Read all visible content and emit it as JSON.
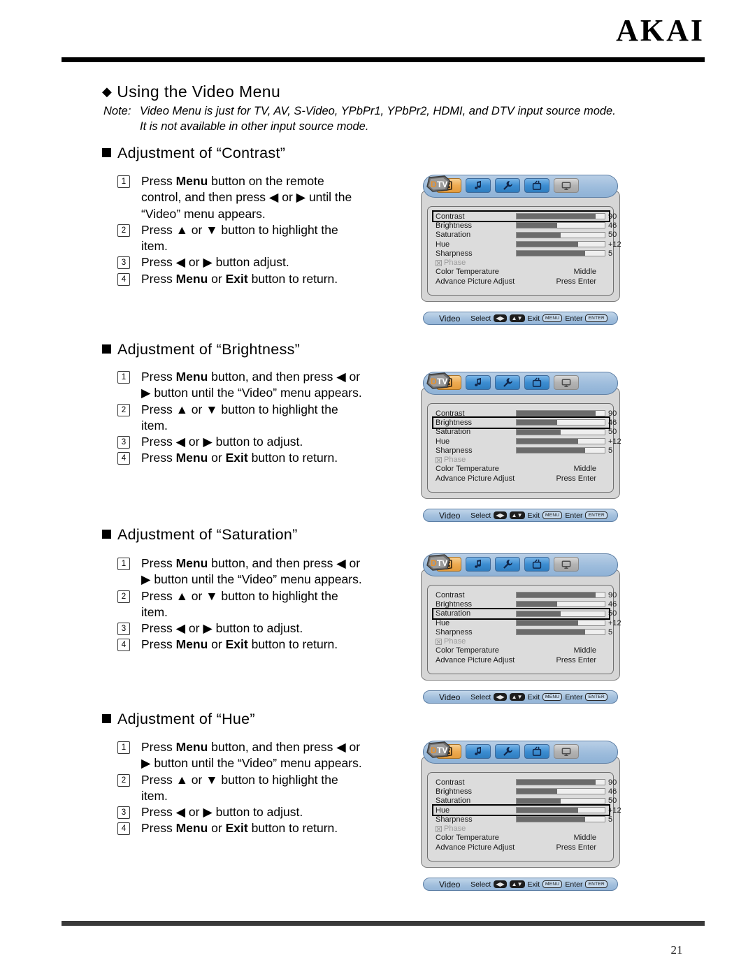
{
  "brand": "AKAI",
  "page_number": "21",
  "section_title": "Using the Video Menu",
  "note": {
    "label": "Note:",
    "line1": "Video Menu is just for TV, AV, S-Video, YPbPr1, YPbPr2, HDMI, and DTV input source mode.",
    "line2": "It is not available in other input source mode."
  },
  "sections": [
    {
      "heading": "Adjustment of “Contrast”",
      "steps": [
        {
          "num": "1",
          "lines": [
            "Press |Menu| button on the remote",
            "control, and then press ◀ or ▶ until the",
            "“Video” menu appears."
          ]
        },
        {
          "num": "2",
          "lines": [
            "Press ▲ or ▼ button to highlight the",
            "item."
          ]
        },
        {
          "num": "3",
          "lines": [
            "Press ◀ or ▶ button adjust."
          ]
        },
        {
          "num": "4",
          "lines": [
            "Press |Menu| or |Exit| button to return."
          ]
        }
      ],
      "selected": "Contrast"
    },
    {
      "heading": "Adjustment of “Brightness”",
      "steps": [
        {
          "num": "1",
          "lines": [
            "Press |Menu| button, and then press ◀ or",
            "▶ button until the “Video” menu appears."
          ]
        },
        {
          "num": "2",
          "lines": [
            "Press ▲ or ▼ button to highlight the",
            "item."
          ]
        },
        {
          "num": "3",
          "lines": [
            "Press ◀ or ▶ button to adjust."
          ]
        },
        {
          "num": "4",
          "lines": [
            "Press |Menu| or |Exit| button to return."
          ]
        }
      ],
      "selected": "Brightness"
    },
    {
      "heading": "Adjustment of “Saturation”",
      "steps": [
        {
          "num": "1",
          "lines": [
            "Press |Menu| button, and then press ◀ or",
            "▶ button until the “Video” menu appears."
          ]
        },
        {
          "num": "2",
          "lines": [
            "Press ▲ or ▼ button to highlight the",
            "item."
          ]
        },
        {
          "num": "3",
          "lines": [
            "Press ◀ or ▶ button to adjust."
          ]
        },
        {
          "num": "4",
          "lines": [
            "Press |Menu| or |Exit| button to return."
          ]
        }
      ],
      "selected": "Saturation"
    },
    {
      "heading": "Adjustment of “Hue”",
      "steps": [
        {
          "num": "1",
          "lines": [
            "Press |Menu| button, and then press ◀ or",
            "▶ button until the “Video” menu appears."
          ]
        },
        {
          "num": "2",
          "lines": [
            "Press ▲ or ▼ button to highlight the",
            "item."
          ]
        },
        {
          "num": "3",
          "lines": [
            "Press ◀ or ▶ button to adjust."
          ]
        },
        {
          "num": "4",
          "lines": [
            "Press |Menu| or |Exit| button to return."
          ]
        }
      ],
      "selected": "Hue"
    }
  ],
  "osd": {
    "tabs": [
      {
        "name": "video-tab",
        "icon": "film-icon",
        "state": "active"
      },
      {
        "name": "audio-tab",
        "icon": "music-note-icon",
        "state": "normal"
      },
      {
        "name": "setup-tab",
        "icon": "wrench-icon",
        "state": "normal"
      },
      {
        "name": "channel-tab",
        "icon": "tv-icon",
        "state": "normal"
      },
      {
        "name": "pc-tab",
        "icon": "monitor-icon",
        "state": "disabled"
      }
    ],
    "logo": {
      "name": "dtv-logo",
      "text_d": "D",
      "text_tv": "TV",
      "color_d": "#e8922c",
      "color_tv": "#ffffff"
    },
    "sliders": [
      {
        "label": "Contrast",
        "value": "90",
        "percent": 90
      },
      {
        "label": "Brightness",
        "value": "46",
        "percent": 46
      },
      {
        "label": "Saturation",
        "value": "50",
        "percent": 50
      },
      {
        "label": "Hue",
        "value": "+12",
        "percent": 70
      },
      {
        "label": "Sharpness",
        "value": "5",
        "percent": 78
      }
    ],
    "phase": {
      "label": "Phase",
      "disabled": true
    },
    "options": [
      {
        "label": "Color Temperature",
        "value": "Middle"
      },
      {
        "label": "Advance Picture Adjust",
        "value": "Press Enter"
      }
    ],
    "footer": {
      "title": "Video",
      "select_label": "Select",
      "select_keys": [
        "◀▶",
        "▲▼"
      ],
      "exit_label": "Exit",
      "exit_key": "MENU",
      "enter_label": "Enter",
      "enter_key": "ENTER"
    }
  },
  "colors": {
    "accent_orange": "#e8a33c",
    "tab_blue": "#3d8ed2",
    "osd_bg": "#dcdcdc",
    "bar_fill": "#6b6b6b",
    "rule": "#000000"
  }
}
